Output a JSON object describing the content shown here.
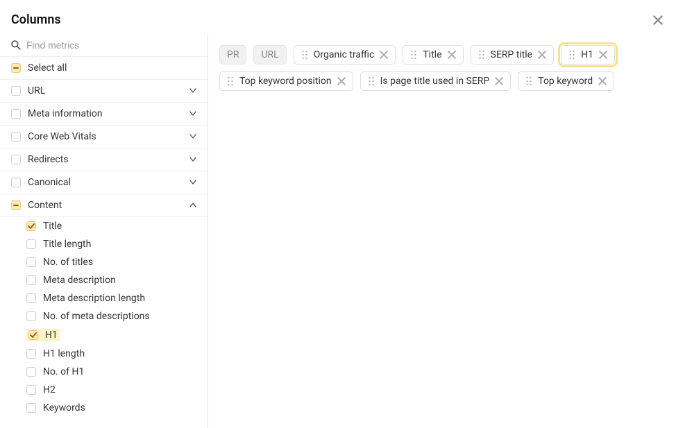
{
  "header": {
    "title": "Columns"
  },
  "search": {
    "placeholder": "Find metrics"
  },
  "sidebar": {
    "select_all": "Select all",
    "groups": [
      {
        "label": "URL",
        "expanded": false
      },
      {
        "label": "Meta information",
        "expanded": false
      },
      {
        "label": "Core Web Vitals",
        "expanded": false
      },
      {
        "label": "Redirects",
        "expanded": false
      },
      {
        "label": "Canonical",
        "expanded": false
      }
    ],
    "content_group": {
      "label": "Content",
      "expanded": true,
      "items": [
        {
          "label": "Title",
          "checked": true,
          "highlight": false
        },
        {
          "label": "Title length",
          "checked": false
        },
        {
          "label": "No. of titles",
          "checked": false
        },
        {
          "label": "Meta description",
          "checked": false
        },
        {
          "label": "Meta description length",
          "checked": false
        },
        {
          "label": "No. of meta descriptions",
          "checked": false
        },
        {
          "label": "H1",
          "checked": true,
          "highlight": true
        },
        {
          "label": "H1 length",
          "checked": false
        },
        {
          "label": "No. of H1",
          "checked": false
        },
        {
          "label": "H2",
          "checked": false
        },
        {
          "label": "Keywords",
          "checked": false
        }
      ]
    }
  },
  "chips": {
    "locked": [
      {
        "label": "PR"
      },
      {
        "label": "URL"
      }
    ],
    "active": [
      {
        "label": "Organic traffic",
        "highlight": false
      },
      {
        "label": "Title",
        "highlight": false
      },
      {
        "label": "SERP title",
        "highlight": false
      },
      {
        "label": "H1",
        "highlight": true
      },
      {
        "label": "Top keyword position",
        "highlight": false
      },
      {
        "label": "Is page title used in SERP",
        "highlight": false
      },
      {
        "label": "Top keyword",
        "highlight": false
      }
    ]
  }
}
